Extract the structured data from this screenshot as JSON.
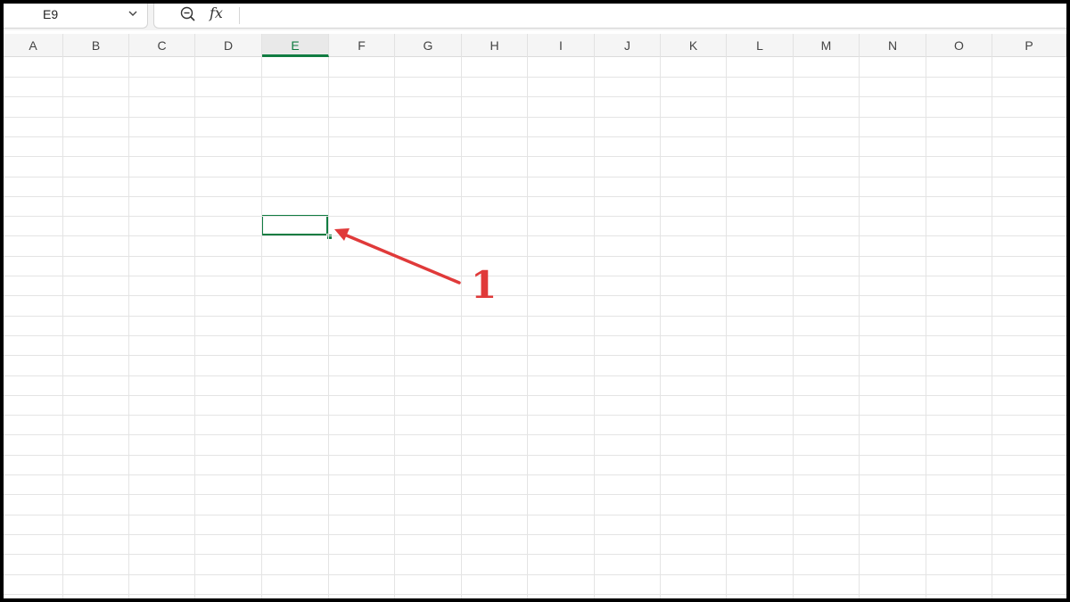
{
  "formula_bar": {
    "name_box_value": "E9",
    "formula_value": "",
    "fx_label": "fx",
    "icons": {
      "chevron": "chevron-down-icon",
      "zoom": "zoom-icon"
    }
  },
  "sheet": {
    "columns": [
      "A",
      "B",
      "C",
      "D",
      "E",
      "F",
      "G",
      "H",
      "I",
      "J",
      "K",
      "L",
      "M",
      "N",
      "O",
      "P"
    ],
    "active_column": "E",
    "selected_cell": "E9",
    "accent_color": "#107c41",
    "gridline_color": "#e4e4e4"
  },
  "annotation": {
    "label": "1",
    "color": "#e03a3a"
  }
}
